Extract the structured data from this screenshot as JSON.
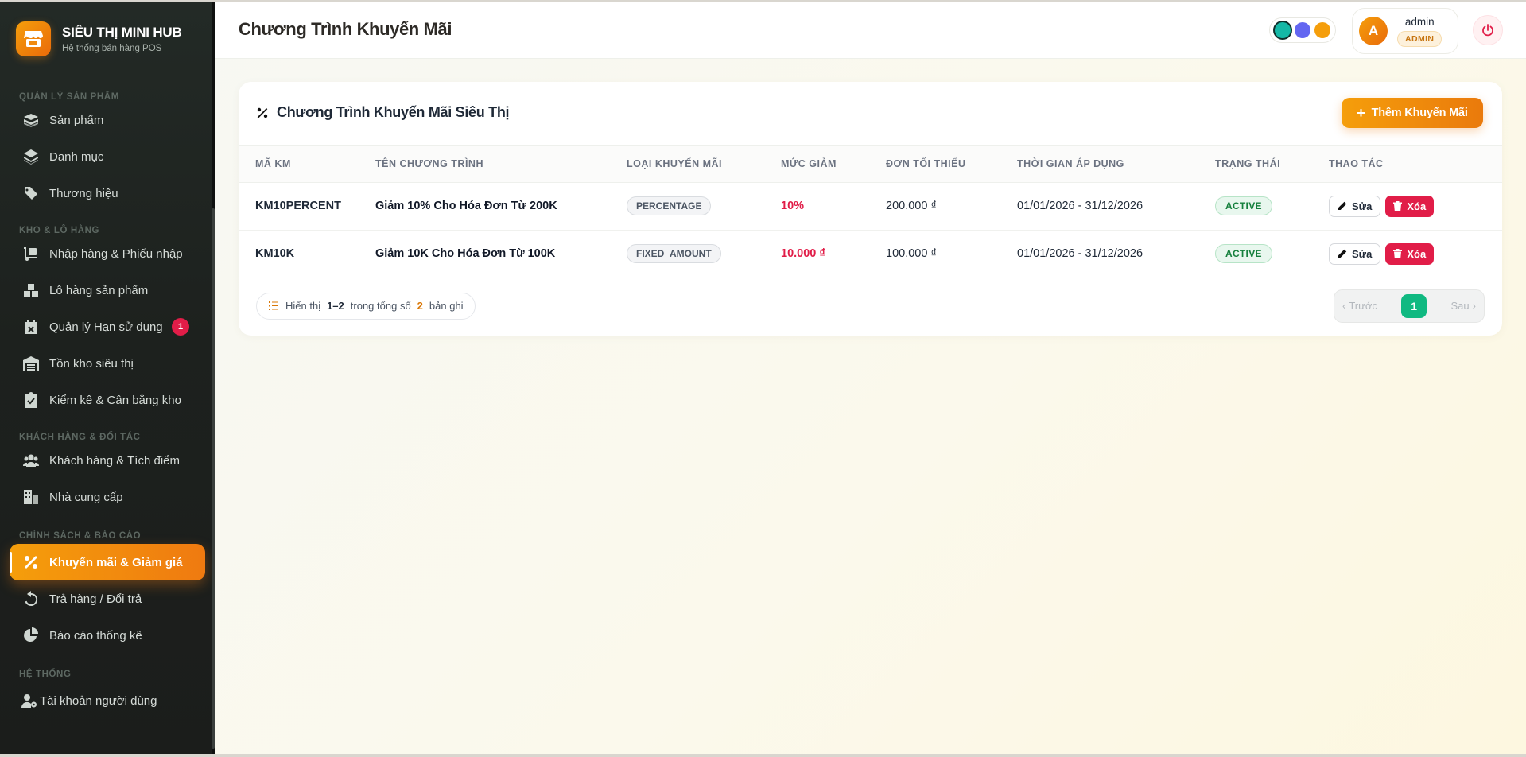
{
  "brand": {
    "name": "SIÊU THỊ MINI HUB",
    "subtitle": "Hệ thống bán hàng POS"
  },
  "sidebar": {
    "sections": [
      {
        "title": "QUẢN LÝ SẢN PHẨM",
        "items": [
          {
            "label": "Sản phẩm",
            "icon": "boxes-icon"
          },
          {
            "label": "Danh mục",
            "icon": "layers-icon"
          },
          {
            "label": "Thương hiệu",
            "icon": "tags-icon"
          }
        ]
      },
      {
        "title": "KHO & LÔ HÀNG",
        "items": [
          {
            "label": "Nhập hàng & Phiếu nhập",
            "icon": "dolly-icon"
          },
          {
            "label": "Lô hàng sản phẩm",
            "icon": "cubes-icon"
          },
          {
            "label": "Quản lý Hạn sử dụng",
            "icon": "calendar-x-icon",
            "badge": "1"
          },
          {
            "label": "Tồn kho siêu thị",
            "icon": "warehouse-icon"
          },
          {
            "label": "Kiểm kê & Cân bằng kho",
            "icon": "clipboard-check-icon"
          }
        ]
      },
      {
        "title": "KHÁCH HÀNG & ĐỐI TÁC",
        "items": [
          {
            "label": "Khách hàng & Tích điểm",
            "icon": "users-icon"
          },
          {
            "label": "Nhà cung cấp",
            "icon": "building-icon"
          }
        ]
      },
      {
        "title": "CHÍNH SÁCH & BÁO CÁO",
        "items": [
          {
            "label": "Khuyến mãi & Giảm giá",
            "icon": "percent-icon",
            "active": true
          },
          {
            "label": "Trả hàng / Đổi trả",
            "icon": "undo-icon"
          },
          {
            "label": "Báo cáo thống kê",
            "icon": "pie-chart-icon"
          }
        ]
      },
      {
        "title": "HỆ THỐNG",
        "items": [
          {
            "label": "Tài khoản người dùng",
            "icon": "user-gear-icon"
          }
        ]
      }
    ]
  },
  "header": {
    "title": "Chương Trình Khuyến Mãi",
    "theme_colors": [
      "#14b8a6",
      "#6366f1",
      "#f59e0b"
    ],
    "user": {
      "initial": "A",
      "name": "admin",
      "role": "ADMIN"
    }
  },
  "card": {
    "title": "Chương Trình Khuyến Mãi Siêu Thị",
    "add_button": "Thêm Khuyến Mãi",
    "columns": [
      "MÃ KM",
      "TÊN CHƯƠNG TRÌNH",
      "LOẠI KHUYẾN MÃI",
      "MỨC GIẢM",
      "ĐƠN TỐI THIỂU",
      "THỜI GIAN ÁP DỤNG",
      "TRẠNG THÁI",
      "THAO TÁC"
    ],
    "rows": [
      {
        "code": "KM10PERCENT",
        "name": "Giảm 10% Cho Hóa Đơn Từ 200K",
        "type": "PERCENTAGE",
        "discount": "10%",
        "min_order": "200.000 ₫",
        "period": "01/01/2026 - 31/12/2026",
        "status": "ACTIVE",
        "edit": "Sửa",
        "delete": "Xóa"
      },
      {
        "code": "KM10K",
        "name": "Giảm 10K Cho Hóa Đơn Từ 100K",
        "type": "FIXED_AMOUNT",
        "discount": "10.000 ₫",
        "min_order": "100.000 ₫",
        "period": "01/01/2026 - 31/12/2026",
        "status": "ACTIVE",
        "edit": "Sửa",
        "delete": "Xóa"
      }
    ],
    "footer": {
      "showing_label": "Hiển thị",
      "range": "1–2",
      "total_label": "trong tổng số",
      "total": "2",
      "records_label": "bản ghi",
      "prev": "Trước",
      "page": "1",
      "next": "Sau"
    }
  },
  "colors": {
    "accent": "#f59e0b",
    "danger": "#e11d48",
    "success": "#10b981"
  }
}
